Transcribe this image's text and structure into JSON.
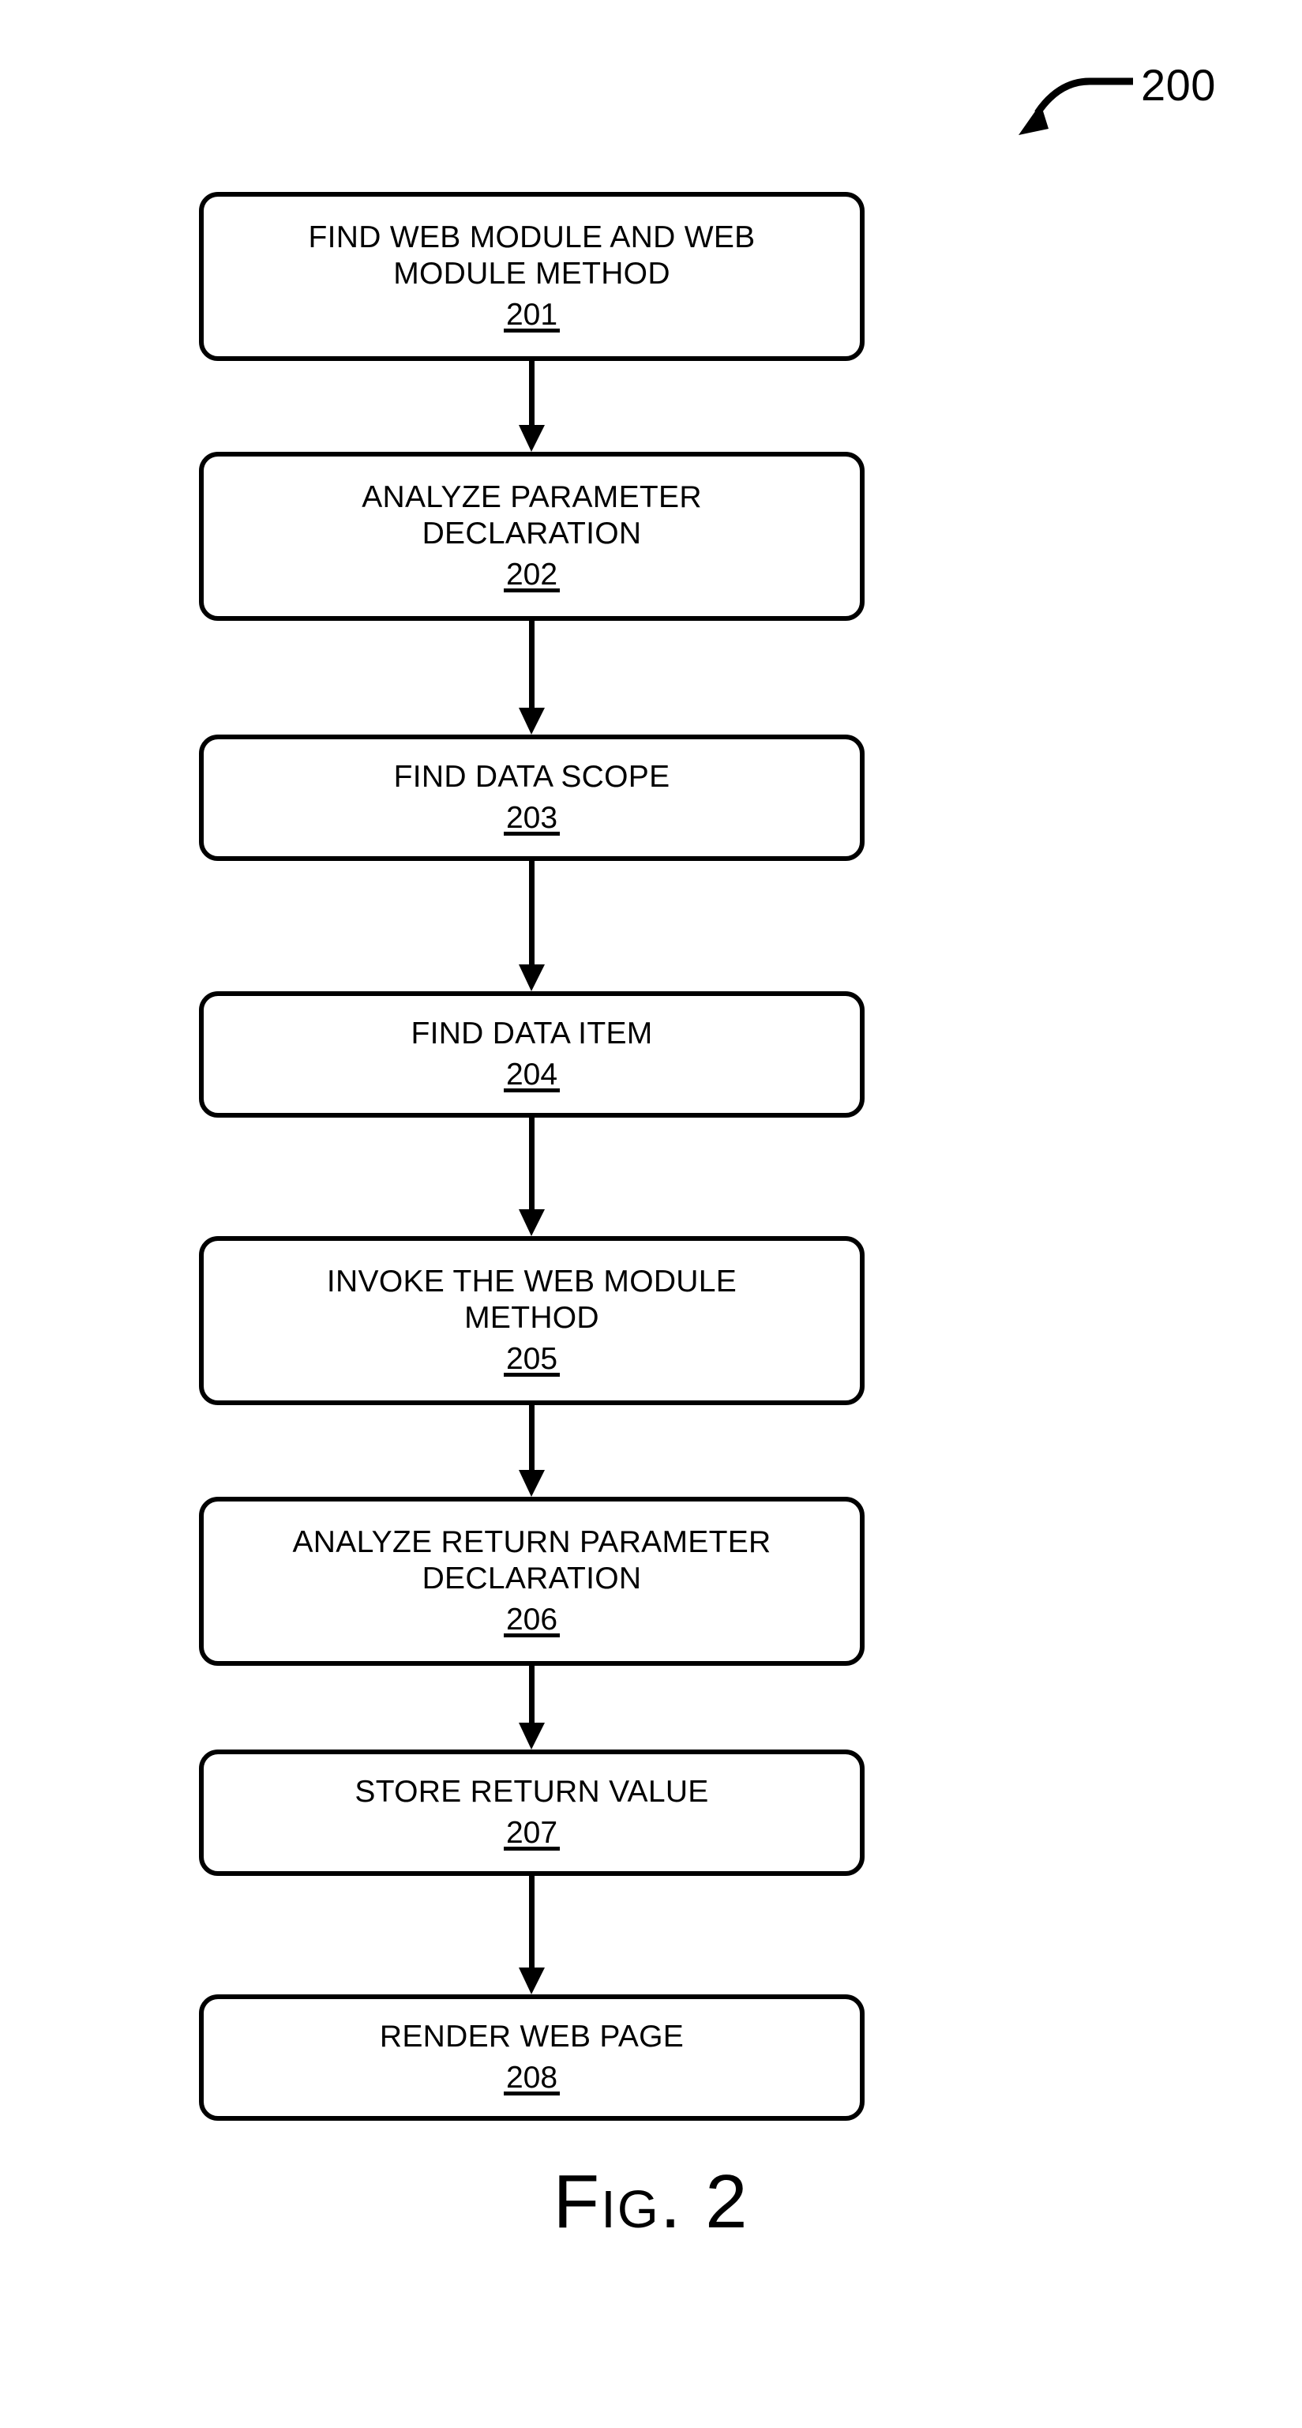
{
  "figure": {
    "reference_number": "200",
    "caption": "Fig. 2",
    "reference_icon": "curved-arrow-icon"
  },
  "flowchart": {
    "type": "flowchart",
    "orientation": "vertical",
    "connector_icon": "down-arrow-icon",
    "steps": [
      {
        "label": "FIND WEB MODULE AND WEB\nMODULE METHOD",
        "number": "201"
      },
      {
        "label": "ANALYZE PARAMETER\nDECLARATION",
        "number": "202"
      },
      {
        "label": "FIND DATA SCOPE",
        "number": "203"
      },
      {
        "label": "FIND DATA ITEM",
        "number": "204"
      },
      {
        "label": "INVOKE THE WEB MODULE\nMETHOD",
        "number": "205"
      },
      {
        "label": "ANALYZE RETURN PARAMETER\nDECLARATION",
        "number": "206"
      },
      {
        "label": "STORE RETURN VALUE",
        "number": "207"
      },
      {
        "label": "RENDER WEB PAGE",
        "number": "208"
      }
    ]
  }
}
